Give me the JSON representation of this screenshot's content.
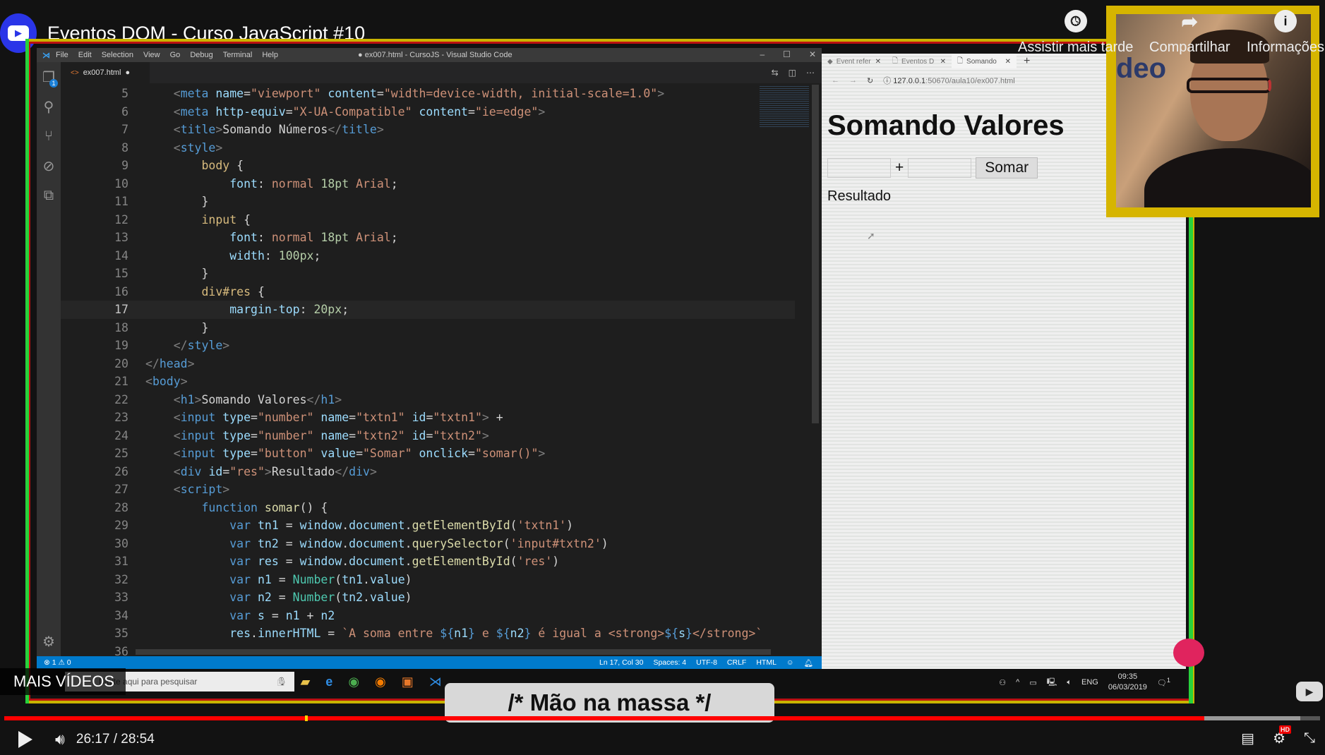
{
  "youtube": {
    "title": "Eventos DOM - Curso JavaScript #10",
    "overlay_buttons": [
      {
        "label": "Assistir mais tarde",
        "icon": "clock-icon"
      },
      {
        "label": "Compartilhar",
        "icon": "share-icon"
      },
      {
        "label": "Informações",
        "icon": "info-icon"
      }
    ],
    "more_videos": "MAIS VÍDEOS",
    "banner": "/* Mão na massa */",
    "webcam_sign": "deo",
    "time_current": "26:17",
    "time_total": "28:54",
    "time_display": "26:17 / 28:54",
    "progress_percent": 91.2,
    "buffer_percent": 98.5,
    "colors": {
      "progress": "#ff0000",
      "frame": "#c9b400",
      "frame_green": "#28d23b"
    }
  },
  "vscode": {
    "menu": [
      "File",
      "Edit",
      "Selection",
      "View",
      "Go",
      "Debug",
      "Terminal",
      "Help"
    ],
    "window_title": "● ex007.html - CursoJS - Visual Studio Code",
    "tab": "ex007.html",
    "explorer_badge": "1",
    "status_left": "⊗ 1 ⚠ 0",
    "status": [
      "Ln 17, Col 30",
      "Spaces: 4",
      "UTF-8",
      "CRLF",
      "HTML"
    ],
    "current_line": 17,
    "code": [
      {
        "n": 5,
        "i": 1,
        "t": [
          [
            "punc",
            "<"
          ],
          [
            "tag",
            "meta "
          ],
          [
            "attr",
            "name"
          ],
          [
            "txt",
            "="
          ],
          [
            "str",
            "\"viewport\" "
          ],
          [
            "attr",
            "content"
          ],
          [
            "txt",
            "="
          ],
          [
            "str",
            "\"width=device-width, initial-scale=1.0\""
          ],
          [
            "punc",
            ">"
          ]
        ]
      },
      {
        "n": 6,
        "i": 1,
        "t": [
          [
            "punc",
            "<"
          ],
          [
            "tag",
            "meta "
          ],
          [
            "attr",
            "http-equiv"
          ],
          [
            "txt",
            "="
          ],
          [
            "str",
            "\"X-UA-Compatible\" "
          ],
          [
            "attr",
            "content"
          ],
          [
            "txt",
            "="
          ],
          [
            "str",
            "\"ie=edge\""
          ],
          [
            "punc",
            ">"
          ]
        ]
      },
      {
        "n": 7,
        "i": 1,
        "t": [
          [
            "punc",
            "<"
          ],
          [
            "tag",
            "title"
          ],
          [
            "punc",
            ">"
          ],
          [
            "txt",
            "Somando Números"
          ],
          [
            "punc",
            "</"
          ],
          [
            "tag",
            "title"
          ],
          [
            "punc",
            ">"
          ]
        ]
      },
      {
        "n": 8,
        "i": 1,
        "t": [
          [
            "punc",
            "<"
          ],
          [
            "tag",
            "style"
          ],
          [
            "punc",
            ">"
          ]
        ]
      },
      {
        "n": 9,
        "i": 2,
        "t": [
          [
            "sel",
            "body "
          ],
          [
            "txt",
            "{"
          ]
        ]
      },
      {
        "n": 10,
        "i": 3,
        "t": [
          [
            "prop",
            "font"
          ],
          [
            "txt",
            ": "
          ],
          [
            "str",
            "normal "
          ],
          [
            "num",
            "18pt "
          ],
          [
            "str",
            "Arial"
          ],
          [
            "txt",
            ";"
          ]
        ]
      },
      {
        "n": 11,
        "i": 2,
        "t": [
          [
            "txt",
            "}"
          ]
        ]
      },
      {
        "n": 12,
        "i": 2,
        "t": [
          [
            "sel",
            "input "
          ],
          [
            "txt",
            "{"
          ]
        ]
      },
      {
        "n": 13,
        "i": 3,
        "t": [
          [
            "prop",
            "font"
          ],
          [
            "txt",
            ": "
          ],
          [
            "str",
            "normal "
          ],
          [
            "num",
            "18pt "
          ],
          [
            "str",
            "Arial"
          ],
          [
            "txt",
            ";"
          ]
        ]
      },
      {
        "n": 14,
        "i": 3,
        "t": [
          [
            "prop",
            "width"
          ],
          [
            "txt",
            ": "
          ],
          [
            "num",
            "100px"
          ],
          [
            "txt",
            ";"
          ]
        ]
      },
      {
        "n": 15,
        "i": 2,
        "t": [
          [
            "txt",
            "}"
          ]
        ]
      },
      {
        "n": 16,
        "i": 2,
        "t": [
          [
            "sel",
            "div#res "
          ],
          [
            "txt",
            "{"
          ]
        ]
      },
      {
        "n": 17,
        "i": 3,
        "t": [
          [
            "prop",
            "margin-top"
          ],
          [
            "txt",
            ": "
          ],
          [
            "num",
            "20px"
          ],
          [
            "txt",
            ";"
          ]
        ]
      },
      {
        "n": 18,
        "i": 2,
        "t": [
          [
            "txt",
            "}"
          ]
        ]
      },
      {
        "n": 19,
        "i": 1,
        "t": [
          [
            "punc",
            "</"
          ],
          [
            "tag",
            "style"
          ],
          [
            "punc",
            ">"
          ]
        ]
      },
      {
        "n": 20,
        "i": 0,
        "t": [
          [
            "punc",
            "</"
          ],
          [
            "tag",
            "head"
          ],
          [
            "punc",
            ">"
          ]
        ]
      },
      {
        "n": 21,
        "i": 0,
        "t": [
          [
            "punc",
            "<"
          ],
          [
            "tag",
            "body"
          ],
          [
            "punc",
            ">"
          ]
        ]
      },
      {
        "n": 22,
        "i": 1,
        "t": [
          [
            "punc",
            "<"
          ],
          [
            "tag",
            "h1"
          ],
          [
            "punc",
            ">"
          ],
          [
            "txt",
            "Somando Valores"
          ],
          [
            "punc",
            "</"
          ],
          [
            "tag",
            "h1"
          ],
          [
            "punc",
            ">"
          ]
        ]
      },
      {
        "n": 23,
        "i": 1,
        "t": [
          [
            "punc",
            "<"
          ],
          [
            "tag",
            "input "
          ],
          [
            "attr",
            "type"
          ],
          [
            "txt",
            "="
          ],
          [
            "str",
            "\"number\" "
          ],
          [
            "attr",
            "name"
          ],
          [
            "txt",
            "="
          ],
          [
            "str",
            "\"txtn1\" "
          ],
          [
            "attr",
            "id"
          ],
          [
            "txt",
            "="
          ],
          [
            "str",
            "\"txtn1\""
          ],
          [
            "punc",
            "> "
          ],
          [
            "txt",
            "+"
          ]
        ]
      },
      {
        "n": 24,
        "i": 1,
        "t": [
          [
            "punc",
            "<"
          ],
          [
            "tag",
            "input "
          ],
          [
            "attr",
            "type"
          ],
          [
            "txt",
            "="
          ],
          [
            "str",
            "\"number\" "
          ],
          [
            "attr",
            "name"
          ],
          [
            "txt",
            "="
          ],
          [
            "str",
            "\"txtn2\" "
          ],
          [
            "attr",
            "id"
          ],
          [
            "txt",
            "="
          ],
          [
            "str",
            "\"txtn2\""
          ],
          [
            "punc",
            ">"
          ]
        ]
      },
      {
        "n": 25,
        "i": 1,
        "t": [
          [
            "punc",
            "<"
          ],
          [
            "tag",
            "input "
          ],
          [
            "attr",
            "type"
          ],
          [
            "txt",
            "="
          ],
          [
            "str",
            "\"button\" "
          ],
          [
            "attr",
            "value"
          ],
          [
            "txt",
            "="
          ],
          [
            "str",
            "\"Somar\" "
          ],
          [
            "attr",
            "onclick"
          ],
          [
            "txt",
            "="
          ],
          [
            "str",
            "\"somar()\""
          ],
          [
            "punc",
            ">"
          ]
        ]
      },
      {
        "n": 26,
        "i": 1,
        "t": [
          [
            "punc",
            "<"
          ],
          [
            "tag",
            "div "
          ],
          [
            "attr",
            "id"
          ],
          [
            "txt",
            "="
          ],
          [
            "str",
            "\"res\""
          ],
          [
            "punc",
            ">"
          ],
          [
            "txt",
            "Resultado"
          ],
          [
            "punc",
            "</"
          ],
          [
            "tag",
            "div"
          ],
          [
            "punc",
            ">"
          ]
        ]
      },
      {
        "n": 27,
        "i": 1,
        "t": [
          [
            "punc",
            "<"
          ],
          [
            "tag",
            "script"
          ],
          [
            "punc",
            ">"
          ]
        ]
      },
      {
        "n": 28,
        "i": 2,
        "t": [
          [
            "kw",
            "function "
          ],
          [
            "fn",
            "somar"
          ],
          [
            "txt",
            "() {"
          ]
        ]
      },
      {
        "n": 29,
        "i": 3,
        "t": [
          [
            "kw",
            "var "
          ],
          [
            "attr",
            "tn1"
          ],
          [
            "txt",
            " = "
          ],
          [
            "attr",
            "window"
          ],
          [
            "txt",
            "."
          ],
          [
            "attr",
            "document"
          ],
          [
            "txt",
            "."
          ],
          [
            "fn",
            "getElementById"
          ],
          [
            "txt",
            "("
          ],
          [
            "str",
            "'txtn1'"
          ],
          [
            "txt",
            ")"
          ]
        ]
      },
      {
        "n": 30,
        "i": 3,
        "t": [
          [
            "kw",
            "var "
          ],
          [
            "attr",
            "tn2"
          ],
          [
            "txt",
            " = "
          ],
          [
            "attr",
            "window"
          ],
          [
            "txt",
            "."
          ],
          [
            "attr",
            "document"
          ],
          [
            "txt",
            "."
          ],
          [
            "fn",
            "querySelector"
          ],
          [
            "txt",
            "("
          ],
          [
            "str",
            "'input#txtn2'"
          ],
          [
            "txt",
            ")"
          ]
        ]
      },
      {
        "n": 31,
        "i": 3,
        "t": [
          [
            "kw",
            "var "
          ],
          [
            "attr",
            "res"
          ],
          [
            "txt",
            " = "
          ],
          [
            "attr",
            "window"
          ],
          [
            "txt",
            "."
          ],
          [
            "attr",
            "document"
          ],
          [
            "txt",
            "."
          ],
          [
            "fn",
            "getElementById"
          ],
          [
            "txt",
            "("
          ],
          [
            "str",
            "'res'"
          ],
          [
            "txt",
            ")"
          ]
        ]
      },
      {
        "n": 32,
        "i": 3,
        "t": [
          [
            "kw",
            "var "
          ],
          [
            "attr",
            "n1"
          ],
          [
            "txt",
            " = "
          ],
          [
            "cls",
            "Number"
          ],
          [
            "txt",
            "("
          ],
          [
            "attr",
            "tn1"
          ],
          [
            "txt",
            "."
          ],
          [
            "attr",
            "value"
          ],
          [
            "txt",
            ")"
          ]
        ]
      },
      {
        "n": 33,
        "i": 3,
        "t": [
          [
            "kw",
            "var "
          ],
          [
            "attr",
            "n2"
          ],
          [
            "txt",
            " = "
          ],
          [
            "cls",
            "Number"
          ],
          [
            "txt",
            "("
          ],
          [
            "attr",
            "tn2"
          ],
          [
            "txt",
            "."
          ],
          [
            "attr",
            "value"
          ],
          [
            "txt",
            ")"
          ]
        ]
      },
      {
        "n": 34,
        "i": 3,
        "t": [
          [
            "kw",
            "var "
          ],
          [
            "attr",
            "s"
          ],
          [
            "txt",
            " = "
          ],
          [
            "attr",
            "n1"
          ],
          [
            "txt",
            " + "
          ],
          [
            "attr",
            "n2"
          ]
        ]
      },
      {
        "n": 35,
        "i": 3,
        "t": [
          [
            "attr",
            "res"
          ],
          [
            "txt",
            "."
          ],
          [
            "attr",
            "innerHTML"
          ],
          [
            "txt",
            " = "
          ],
          [
            "str",
            "`A soma entre "
          ],
          [
            "kw",
            "${"
          ],
          [
            "attr",
            "n1"
          ],
          [
            "kw",
            "}"
          ],
          [
            "str",
            " e "
          ],
          [
            "kw",
            "${"
          ],
          [
            "attr",
            "n2"
          ],
          [
            "kw",
            "}"
          ],
          [
            "str",
            " é igual a <strong>"
          ],
          [
            "kw",
            "${"
          ],
          [
            "attr",
            "s"
          ],
          [
            "kw",
            "}"
          ],
          [
            "str",
            "</strong>`"
          ]
        ]
      },
      {
        "n": 36,
        "i": 0,
        "t": []
      }
    ]
  },
  "browser": {
    "tabs": [
      {
        "label": "Event refer",
        "active": false
      },
      {
        "label": "Eventos D",
        "active": false
      },
      {
        "label": "Somando",
        "active": true
      }
    ],
    "url_host": "127.0.0.1",
    "url_rest": ":50670/aula10/ex007.html",
    "page": {
      "heading": "Somando Valores",
      "plus": "+",
      "button": "Somar",
      "result": "Resultado",
      "input1_value": "",
      "input2_value": ""
    }
  },
  "taskbar": {
    "search_placeholder": "Digite aqui para pesquisar",
    "lang": "ENG",
    "time": "09:35",
    "date": "06/03/2019",
    "notifications": "1"
  }
}
